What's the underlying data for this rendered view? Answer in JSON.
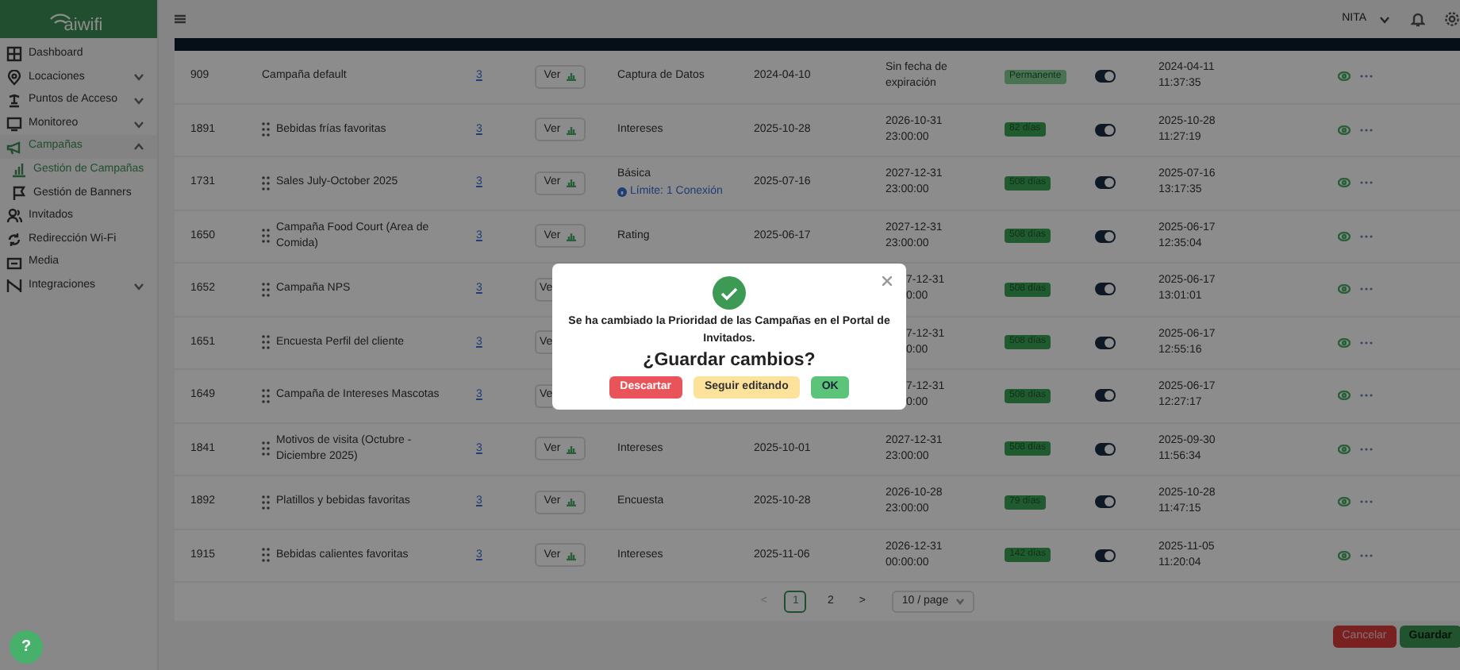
{
  "brand": {
    "logo": "aiwifi"
  },
  "sidebar": {
    "items": [
      {
        "label": "Dashboard",
        "selected": false
      },
      {
        "label": "Locaciones",
        "expanded": false,
        "selected": false
      },
      {
        "label": "Puntos de Acceso",
        "expanded": false,
        "selected": false
      },
      {
        "label": "Monitoreo",
        "expanded": false,
        "selected": false
      },
      {
        "label": "Campañas",
        "expanded": true,
        "selected": true,
        "children": [
          {
            "label": "Gestión de Campañas",
            "selected": true
          },
          {
            "label": "Gestión de Banners",
            "selected": false
          }
        ]
      },
      {
        "label": "Invitados",
        "selected": false
      },
      {
        "label": "Redirección Wi-Fi",
        "selected": false
      },
      {
        "label": "Media",
        "selected": false
      },
      {
        "label": "Integraciones",
        "expanded": false,
        "selected": false
      }
    ]
  },
  "topbar": {
    "user": "NITA"
  },
  "table": {
    "rows": [
      {
        "id": "909",
        "name": "Campaña default",
        "draggable": false,
        "count": "3",
        "ver": "Ver",
        "type": "Captura de Datos",
        "start": "2024-04-10",
        "end": [
          "Sin fecha de",
          "expiración"
        ],
        "badge": {
          "text": "Permanente",
          "kind": "permanent"
        },
        "active": true,
        "updated": [
          "2024-04-11",
          "11:37:35"
        ]
      },
      {
        "id": "1891",
        "name": "Bebidas frías favoritas",
        "draggable": true,
        "count": "3",
        "ver": "Ver",
        "type": "Intereses",
        "start": "2025-10-28",
        "end": [
          "2026-10-31",
          "23:00:00"
        ],
        "badge": {
          "text": "82 días",
          "kind": "countdown"
        },
        "active": true,
        "updated": [
          "2025-10-28",
          "11:27:19"
        ]
      },
      {
        "id": "1731",
        "name": "Sales July-October 2025",
        "draggable": true,
        "count": "3",
        "ver": "Ver",
        "type": "Básica",
        "type_note": "Límite: 1 Conexión",
        "start": "2025-07-16",
        "end": [
          "2027-12-31",
          "23:00:00"
        ],
        "badge": {
          "text": "508 días",
          "kind": "countdown"
        },
        "active": true,
        "updated": [
          "2025-07-16",
          "13:17:35"
        ]
      },
      {
        "id": "1650",
        "name": "Campaña Food Court (Area de Comida)",
        "draggable": true,
        "count": "3",
        "ver": "Ver",
        "type": "Rating",
        "start": "2025-06-17",
        "end": [
          "2027-12-31",
          "23:00:00"
        ],
        "badge": {
          "text": "508 días",
          "kind": "countdown"
        },
        "active": true,
        "updated": [
          "2025-06-17",
          "12:35:04"
        ]
      },
      {
        "id": "1652",
        "name": "Campaña NPS",
        "draggable": true,
        "count": "3",
        "ver": "Ve",
        "covered": true,
        "end": [
          "7-12-31",
          "0:00"
        ],
        "badge": {
          "text": "508 días",
          "kind": "countdown"
        },
        "active": true,
        "updated": [
          "2025-06-17",
          "13:01:01"
        ]
      },
      {
        "id": "1651",
        "name": "Encuesta Perfil del cliente",
        "draggable": true,
        "count": "3",
        "ver": "Ve",
        "covered": true,
        "end": [
          "7-12-31",
          "0:00"
        ],
        "badge": {
          "text": "508 días",
          "kind": "countdown"
        },
        "active": true,
        "updated": [
          "2025-06-17",
          "12:55:16"
        ]
      },
      {
        "id": "1649",
        "name": "Campaña de Intereses Mascotas",
        "draggable": true,
        "count": "3",
        "ver": "Ve",
        "covered": true,
        "end": [
          "7-12-31",
          "0:00"
        ],
        "badge": {
          "text": "508 días",
          "kind": "countdown"
        },
        "active": true,
        "updated": [
          "2025-06-17",
          "12:27:17"
        ]
      },
      {
        "id": "1841",
        "name": "Motivos de visita (Octubre - Diciembre 2025)",
        "draggable": true,
        "count": "3",
        "ver": "Ver",
        "type": "Intereses",
        "start": "2025-10-01",
        "end": [
          "2027-12-31",
          "23:00:00"
        ],
        "badge": {
          "text": "508 días",
          "kind": "countdown"
        },
        "active": true,
        "updated": [
          "2025-09-30",
          "11:56:34"
        ]
      },
      {
        "id": "1892",
        "name": "Platillos y bebidas favoritas",
        "draggable": true,
        "count": "3",
        "ver": "Ver",
        "type": "Encuesta",
        "start": "2025-10-28",
        "end": [
          "2026-10-28",
          "23:00:00"
        ],
        "badge": {
          "text": "79 días",
          "kind": "countdown"
        },
        "active": true,
        "updated": [
          "2025-10-28",
          "11:47:15"
        ]
      },
      {
        "id": "1915",
        "name": "Bebidas calientes favoritas",
        "draggable": true,
        "count": "3",
        "ver": "Ver",
        "type": "Intereses",
        "start": "2025-11-06",
        "end": [
          "2026-12-31",
          "00:00:00"
        ],
        "badge": {
          "text": "142 días",
          "kind": "countdown"
        },
        "active": true,
        "updated": [
          "2025-11-05",
          "11:20:04"
        ]
      }
    ]
  },
  "pagination": {
    "prev": "<",
    "pages": [
      {
        "label": "1",
        "selected": true
      },
      {
        "label": "2",
        "selected": false
      }
    ],
    "next": ">",
    "page_size": "10 / page"
  },
  "footer": {
    "cancel": "Cancelar",
    "save": "Guardar"
  },
  "help": "?",
  "dialog": {
    "message": "Se ha cambiado la Prioridad de las Campañas en el Portal de Invitados.",
    "question": "¿Guardar cambios?",
    "buttons": [
      {
        "label": "Descartar",
        "kind": "danger"
      },
      {
        "label": "Seguir editando",
        "kind": "warning"
      },
      {
        "label": "OK",
        "kind": "success"
      }
    ]
  }
}
